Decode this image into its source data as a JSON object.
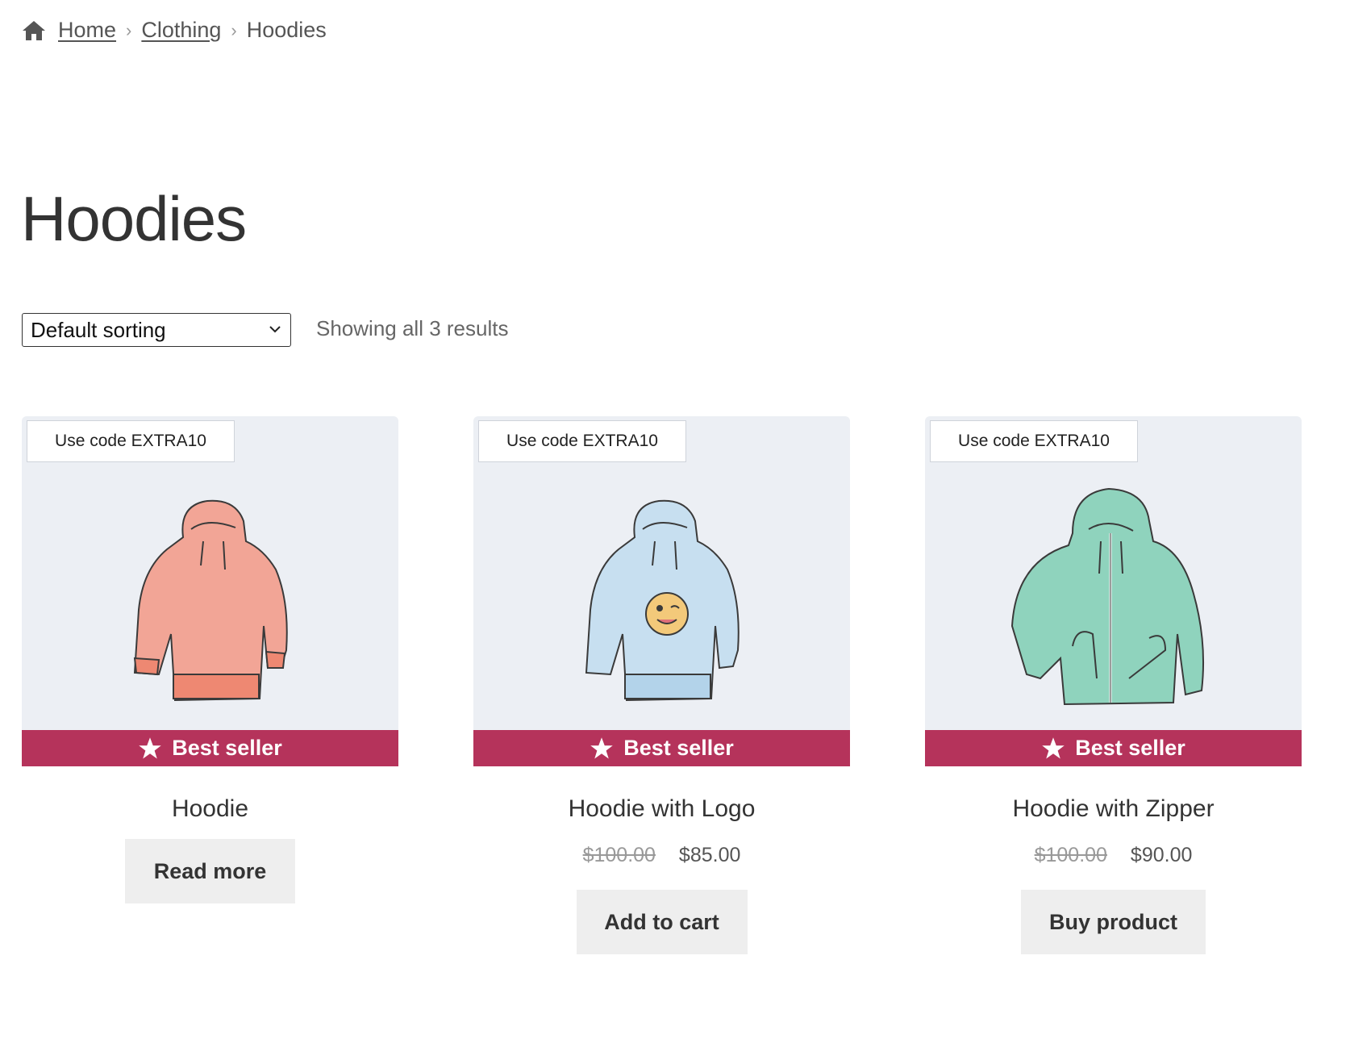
{
  "breadcrumb": {
    "home": "Home",
    "clothing": "Clothing",
    "current": "Hoodies",
    "icon": "home-icon"
  },
  "page_title": "Hoodies",
  "sorting": {
    "selected": "Default sorting"
  },
  "result_count": "Showing all 3 results",
  "colors": {
    "accent": "#b5335b",
    "card_bg": "#eceff4",
    "button_bg": "#eeeeee"
  },
  "products": [
    {
      "badge": "Use code EXTRA10",
      "bestseller": "Best seller",
      "title": "Hoodie",
      "button": "Read more",
      "image_color": "#f2a596"
    },
    {
      "badge": "Use code EXTRA10",
      "bestseller": "Best seller",
      "title": "Hoodie with Logo",
      "old_price": "$100.00",
      "price": "$85.00",
      "button": "Add to cart",
      "image_color": "#c7dff0"
    },
    {
      "badge": "Use code EXTRA10",
      "bestseller": "Best seller",
      "title": "Hoodie with Zipper",
      "old_price": "$100.00",
      "price": "$90.00",
      "button": "Buy product",
      "image_color": "#8fd3bd"
    }
  ]
}
